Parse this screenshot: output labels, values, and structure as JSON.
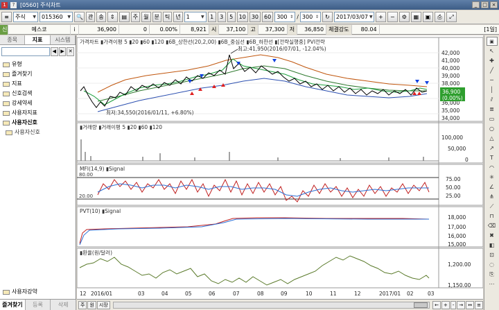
{
  "window": {
    "code_badge": "1",
    "help_badge": "?",
    "title": "[0560] 주식차트",
    "buttons": [
      "_",
      "□",
      "×"
    ]
  },
  "toolbar": {
    "market_select": "주식",
    "stock_code": "015360",
    "btn_gwan": "관",
    "btn_sang": "송",
    "period_buttons": [
      "주",
      "월",
      "분",
      "틱",
      "년"
    ],
    "interval_select": "1",
    "interval_buttons": [
      "1",
      "3",
      "5",
      "10",
      "30",
      "60"
    ],
    "count_value": "300",
    "count_total": "300",
    "date": "2017/03/07",
    "layout_label": "[1일]"
  },
  "quote": {
    "badge": "신",
    "name": "예스코",
    "info": "i",
    "price": "36,900",
    "change": "0",
    "change_rate": "0.00%",
    "volume": "8,921",
    "open_label": "시",
    "open": "37,100",
    "high_label": "고",
    "high": "37,300",
    "low_label": "저",
    "low": "36,850",
    "strength_label": "체결강도",
    "strength": "80.04"
  },
  "sidebar": {
    "tabs": [
      "종목",
      "지표",
      "시스템"
    ],
    "active_tab": 1,
    "search_placeholder": "",
    "tree": [
      {
        "label": "유형",
        "bold": false
      },
      {
        "label": "즐겨찾기",
        "bold": false
      },
      {
        "label": "지표",
        "bold": false
      },
      {
        "label": "신호검색",
        "bold": false
      },
      {
        "label": "강세약세",
        "bold": false
      },
      {
        "label": "사용자지표",
        "bold": false
      },
      {
        "label": "사용자신호",
        "bold": true
      }
    ],
    "subitem": "사용자신호",
    "bottom_item": "사용자강약",
    "bottom_tabs": [
      "즐겨찾기",
      "등록",
      "삭제"
    ]
  },
  "chart": {
    "price_panel": {
      "legend": "가격차트 ▮가격이평 5 ▮20 ▮60 ▮120 ▮6B_상한선(20,2,00) ▮6B_중심선 ▮6B_하한선 ▮[전략실행중] PVI전략",
      "max_annotation": "최고:41,950(2016/07/01, -12.04%)",
      "min_annotation": "최저:34,550(2016/01/11, +6.80%)",
      "y_ticks": [
        "42,000",
        "41,000",
        "40,000",
        "39,000",
        "38,000",
        "37,000",
        "36,000",
        "35,000",
        "34,000"
      ],
      "last_price": "36,900",
      "last_change": "(0.00%)"
    },
    "volume_panel": {
      "legend": "▮거래량 ▮거래이평 5 ▮20 ▮60 ▮120",
      "y_ticks": [
        "100,000",
        "50,000",
        "0"
      ]
    },
    "mfi_panel": {
      "legend": "MFI(14,9) ▮Signal",
      "upper": "80.00",
      "lower": "20.00",
      "y_ticks": [
        "75.00",
        "50.00",
        "25.00"
      ]
    },
    "pvt_panel": {
      "legend": "PVT(10) ▮Signal",
      "y_ticks": [
        "18,000",
        "17,000",
        "16,000",
        "15,000"
      ]
    },
    "fx_panel": {
      "legend": "▮환율(원/달러)",
      "y_ticks": [
        "1,200.00",
        "1,150.00"
      ]
    },
    "x_axis": [
      "12",
      "2016/01",
      "03",
      "04",
      "05",
      "06",
      "07",
      "08",
      "09",
      "10",
      "11",
      "12",
      "2017/01",
      "02",
      "03"
    ]
  },
  "status_bar": {
    "buttons_left": [
      "주",
      "원",
      "시장"
    ],
    "buttons_right": [
      "←",
      "+",
      "-",
      "→",
      "↔",
      "≡"
    ]
  },
  "colors": {
    "price_line": "#000000",
    "ma5": "#1a9e3a",
    "ma20": "#2a6fd6",
    "upper_band": "#c0550c",
    "mid_band": "#2f7a2f",
    "lower_band": "#2b4fb0",
    "buy_signal": "#e02020",
    "sell_signal": "#1040e0",
    "mfi": "#c02020",
    "fx": "#5a7a2a",
    "last_price_bg": "#2e9e2e"
  }
}
